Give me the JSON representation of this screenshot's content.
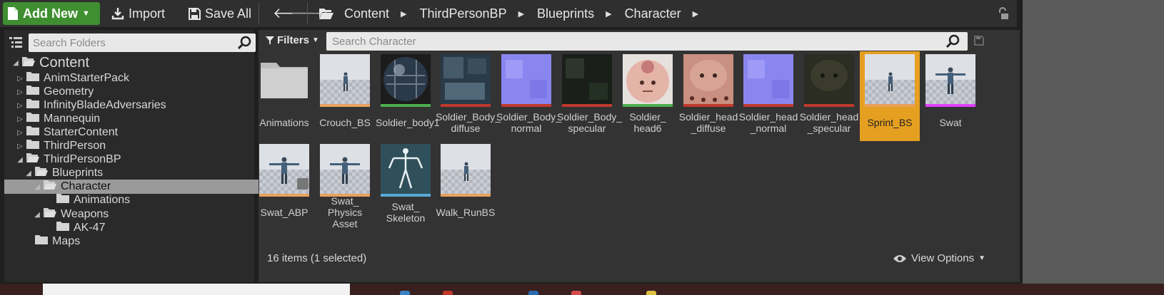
{
  "toolbar": {
    "add_new": "Add New",
    "import": "Import",
    "save_all": "Save All",
    "path": [
      "Content",
      "ThirdPersonBP",
      "Blueprints",
      "Character"
    ]
  },
  "folders": {
    "search_placeholder": "Search Folders",
    "tree": [
      {
        "label": "Content",
        "depth": 0,
        "expanded": true
      },
      {
        "label": "AnimStarterPack",
        "depth": 1,
        "expanded": false
      },
      {
        "label": "Geometry",
        "depth": 1,
        "expanded": false
      },
      {
        "label": "InfinityBladeAdversaries",
        "depth": 1,
        "expanded": false
      },
      {
        "label": "Mannequin",
        "depth": 1,
        "expanded": false
      },
      {
        "label": "StarterContent",
        "depth": 1,
        "expanded": false
      },
      {
        "label": "ThirdPerson",
        "depth": 1,
        "expanded": false
      },
      {
        "label": "ThirdPersonBP",
        "depth": 1,
        "expanded": true
      },
      {
        "label": "Blueprints",
        "depth": 2,
        "expanded": true
      },
      {
        "label": "Character",
        "depth": 3,
        "expanded": true,
        "selected": true
      },
      {
        "label": "Animations",
        "depth": 4
      },
      {
        "label": "Weapons",
        "depth": 3,
        "expanded": true
      },
      {
        "label": "AK-47",
        "depth": 4
      },
      {
        "label": "Maps",
        "depth": 2
      }
    ]
  },
  "assets": {
    "filters_label": "Filters",
    "search_placeholder": "Search Character",
    "items": [
      {
        "name": "Animations",
        "kind": "folder",
        "bar": "#888888"
      },
      {
        "name": "Crouch_BS",
        "kind": "blendspace",
        "bar": "#e8a15c"
      },
      {
        "name": "Soldier_body1",
        "kind": "material",
        "bar": "#4caf50"
      },
      {
        "name": "Soldier_Body_\ndiffuse",
        "kind": "texture-diffuse",
        "bar": "#c0392b"
      },
      {
        "name": "Soldier_Body_\nnormal",
        "kind": "texture-normal",
        "bar": "#c0392b"
      },
      {
        "name": "Soldier_Body_\nspecular",
        "kind": "texture-specular",
        "bar": "#c0392b"
      },
      {
        "name": "Soldier_\nhead6",
        "kind": "material-head",
        "bar": "#4caf50"
      },
      {
        "name": "Soldier_head\n_diffuse",
        "kind": "texture-head",
        "bar": "#c0392b"
      },
      {
        "name": "Soldier_head\n_normal",
        "kind": "texture-normal",
        "bar": "#c0392b"
      },
      {
        "name": "Soldier_head\n_specular",
        "kind": "texture-head-dark",
        "bar": "#c0392b"
      },
      {
        "name": "Sprint_BS",
        "kind": "blendspace",
        "bar": "#e8a15c",
        "selected": true
      },
      {
        "name": "Swat",
        "kind": "mesh",
        "bar": "#e040fb"
      },
      {
        "name": "Swat_ABP",
        "kind": "anim-bp",
        "bar": "#e8a15c"
      },
      {
        "name": "Swat_\nPhysics\nAsset",
        "kind": "physics",
        "bar": "#e8a15c"
      },
      {
        "name": "Swat_\nSkeleton",
        "kind": "skeleton",
        "bar": "#5aa7d6"
      },
      {
        "name": "Walk_RunBS",
        "kind": "blendspace",
        "bar": "#e8a15c"
      }
    ],
    "status": "16 items (1 selected)",
    "view_options": "View Options"
  },
  "colors": {
    "accent_green": "#3f8f30",
    "selection": "#e5a021"
  }
}
